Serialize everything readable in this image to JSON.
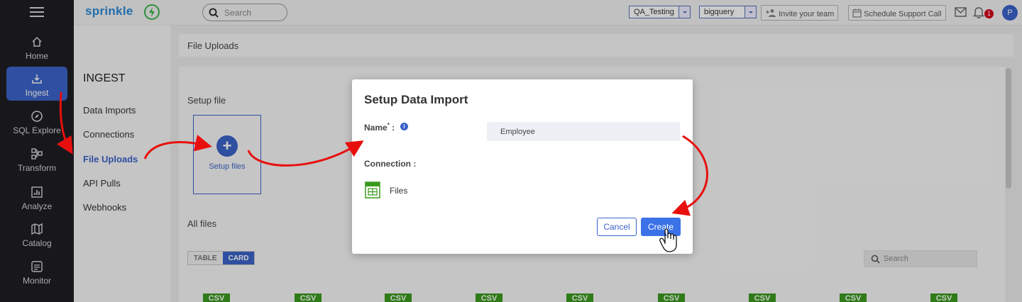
{
  "app": {
    "brand": "sprinkle"
  },
  "nav": {
    "items": [
      {
        "label": "Home",
        "icon": "home-icon"
      },
      {
        "label": "Ingest",
        "icon": "inbox-download-icon"
      },
      {
        "label": "SQL Explore",
        "icon": "compass-icon"
      },
      {
        "label": "Transform",
        "icon": "flow-icon"
      },
      {
        "label": "Analyze",
        "icon": "bar-chart-icon"
      },
      {
        "label": "Catalog",
        "icon": "map-icon"
      },
      {
        "label": "Monitor",
        "icon": "monitor-icon"
      }
    ],
    "active": "Ingest"
  },
  "topbar": {
    "search_placeholder": "Search",
    "workspace": "QA_Testing",
    "warehouse": "bigquery",
    "invite_label": "Invite your team",
    "support_label": "Schedule Support Call",
    "notification_count": "1",
    "avatar_initial": "P"
  },
  "ingest": {
    "heading": "INGEST",
    "items": [
      "Data Imports",
      "Connections",
      "File Uploads",
      "API Pulls",
      "Webhooks"
    ],
    "active": "File Uploads"
  },
  "page": {
    "breadcrumb": "File Uploads",
    "setup_file_label": "Setup file",
    "setup_files_button": "Setup files",
    "all_files_label": "All files",
    "view_table": "TABLE",
    "view_card": "CARD",
    "files_search_placeholder": "Search",
    "file_badge": "CSV"
  },
  "modal": {
    "title": "Setup Data Import",
    "name_label": "Name",
    "required_mark": "*",
    "name_colon": " :",
    "name_value": "Employee",
    "connection_label": "Connection :",
    "connection_name": "Files",
    "cancel_label": "Cancel",
    "create_label": "Create"
  },
  "colors": {
    "accent": "#3b63c9",
    "create_button": "#3b72e8",
    "csv_badge": "#3a9a1e",
    "annotation_arrow": "#e8100e"
  }
}
